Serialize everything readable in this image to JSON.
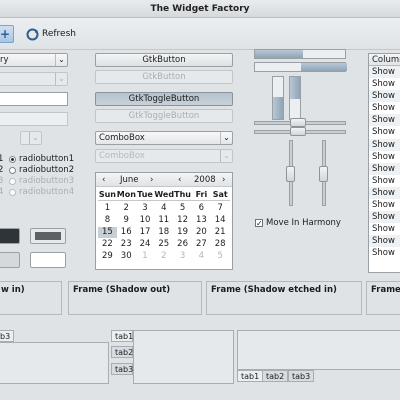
{
  "window": {
    "title": "The Widget Factory"
  },
  "toolbar": {
    "refresh_label": "Refresh"
  },
  "left": {
    "combo_text": "ry",
    "radios": [
      {
        "label": "radiobutton1",
        "checked": true,
        "enabled": true
      },
      {
        "label": "radiobutton2",
        "checked": false,
        "enabled": true
      },
      {
        "label": "radiobutton3",
        "checked": false,
        "enabled": false
      },
      {
        "label": "radiobutton4",
        "checked": false,
        "enabled": false
      }
    ],
    "radio_numbers": [
      "1",
      "2",
      "3",
      "4"
    ]
  },
  "middle": {
    "button_label": "GtkButton",
    "button_disabled_label": "GtkButton",
    "toggle_label": "GtkToggleButton",
    "toggle_disabled_label": "GtkToggleButton",
    "combobox_label": "ComboBox",
    "combobox_disabled_label": "ComboBox"
  },
  "calendar": {
    "month": "June",
    "year": "2008",
    "prev_month": "‹",
    "next_month": "›",
    "prev_year": "‹",
    "next_year": "›",
    "weekdays": [
      "Sun",
      "Mon",
      "Tue",
      "Wed",
      "Thu",
      "Fri",
      "Sat"
    ],
    "weeks": [
      [
        "1",
        "2",
        "3",
        "4",
        "5",
        "6",
        "7"
      ],
      [
        "8",
        "9",
        "10",
        "11",
        "12",
        "13",
        "14"
      ],
      [
        "15",
        "16",
        "17",
        "18",
        "19",
        "20",
        "21"
      ],
      [
        "22",
        "23",
        "24",
        "25",
        "26",
        "27",
        "28"
      ],
      [
        "29",
        "30",
        "1",
        "2",
        "3",
        "4",
        "5"
      ]
    ],
    "selected_day": "15"
  },
  "scales": {
    "move_in_harmony_label": "Move In Harmony",
    "move_in_harmony_checked": true
  },
  "listview": {
    "column_header": "Column",
    "rows": [
      "Show",
      "Show",
      "Show",
      "Show",
      "Show",
      "Show",
      "Show",
      "Show",
      "Show",
      "Show",
      "Show",
      "Show",
      "Show",
      "Show",
      "Show",
      "Show"
    ]
  },
  "frames": [
    {
      "label": "w in)"
    },
    {
      "label": "Frame (Shadow out)"
    },
    {
      "label": "Frame (Shadow etched in)"
    },
    {
      "label": "Frame"
    }
  ],
  "notebooks": {
    "left_tab": "b3",
    "middle_tabs": [
      "tab1",
      "tab2",
      "tab3"
    ],
    "right_tabs": [
      "tab1",
      "tab2",
      "tab3"
    ]
  },
  "colors": {
    "accent": "#a9c5e2",
    "selection": "#c7ced4"
  }
}
